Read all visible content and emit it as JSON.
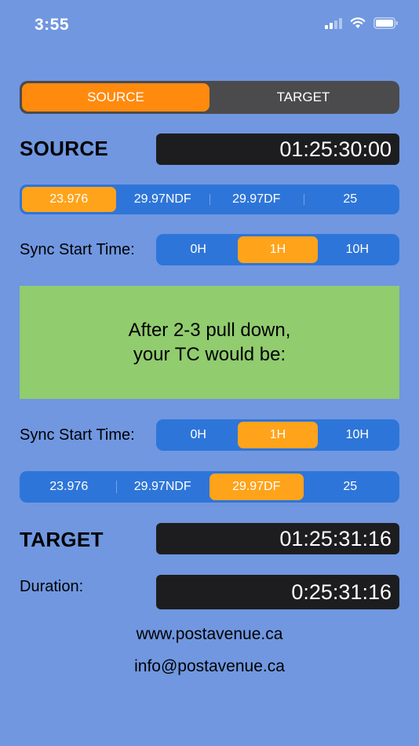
{
  "status_bar": {
    "time": "3:55"
  },
  "mode_toggle": {
    "options": [
      "SOURCE",
      "TARGET"
    ],
    "selected": "SOURCE"
  },
  "source": {
    "label": "SOURCE",
    "timecode": "01:25:30:00",
    "framerates": [
      "23.976",
      "29.97NDF",
      "29.97DF",
      "25"
    ],
    "selected_framerate": "23.976",
    "sync_label": "Sync Start Time:",
    "sync_options": [
      "0H",
      "1H",
      "10H"
    ],
    "selected_sync": "1H"
  },
  "message": {
    "line1": "After 2-3 pull down,",
    "line2": "your TC would be:"
  },
  "target": {
    "sync_label": "Sync Start Time:",
    "sync_options": [
      "0H",
      "1H",
      "10H"
    ],
    "selected_sync": "1H",
    "framerates": [
      "23.976",
      "29.97NDF",
      "29.97DF",
      "25"
    ],
    "selected_framerate": "29.97DF",
    "label": "TARGET",
    "timecode": "01:25:31:16"
  },
  "duration": {
    "label": "Duration:",
    "value": "0:25:31:16"
  },
  "footer": {
    "website": "www.postavenue.ca",
    "email": "info@postavenue.ca"
  },
  "colors": {
    "background": "#7097E0",
    "accent": "#FF8A0D",
    "segment_blue": "#2E75D9",
    "message_green": "#91CC6F",
    "timecode_bg": "#1D1D1F"
  },
  "icons": [
    "signal-icon",
    "wifi-icon",
    "battery-icon"
  ]
}
